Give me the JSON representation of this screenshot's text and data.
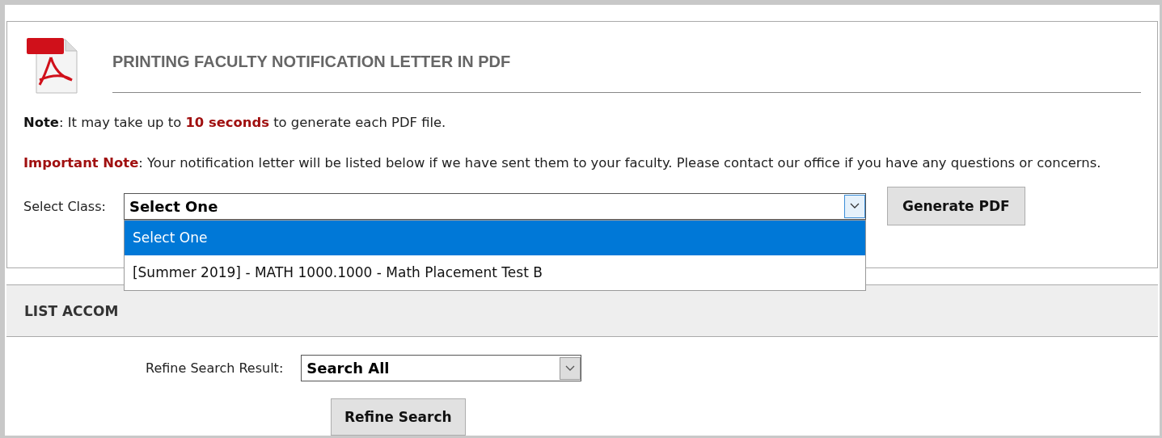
{
  "panel": {
    "title": "PRINTING FACULTY NOTIFICATION LETTER IN PDF",
    "note": [
      {
        "kind": "label",
        "text": "Note"
      },
      {
        "kind": "plain",
        "text": ": It may take up to "
      },
      {
        "kind": "emphasis",
        "text": "10 seconds"
      },
      {
        "kind": "plain",
        "text": " to generate each PDF file."
      }
    ],
    "important_note": [
      {
        "kind": "alert",
        "text": "Important Note"
      },
      {
        "kind": "plain",
        "text": ": Your notification letter will be listed below if we have sent them to your faculty. Please contact our office if you have any questions or concerns."
      }
    ],
    "class_select": {
      "label": "Select Class:",
      "value": "Select One",
      "expanded": true,
      "options": [
        {
          "label": "Select One",
          "selected": true
        },
        {
          "label": "[Summer 2019] - MATH 1000.1000 - Math Placement Test B",
          "selected": false
        }
      ]
    },
    "generate_button": "Generate PDF"
  },
  "section": {
    "title": "LIST ACCOM"
  },
  "refine": {
    "label": "Refine Search Result:",
    "value": "Search All",
    "button": "Refine Search"
  }
}
